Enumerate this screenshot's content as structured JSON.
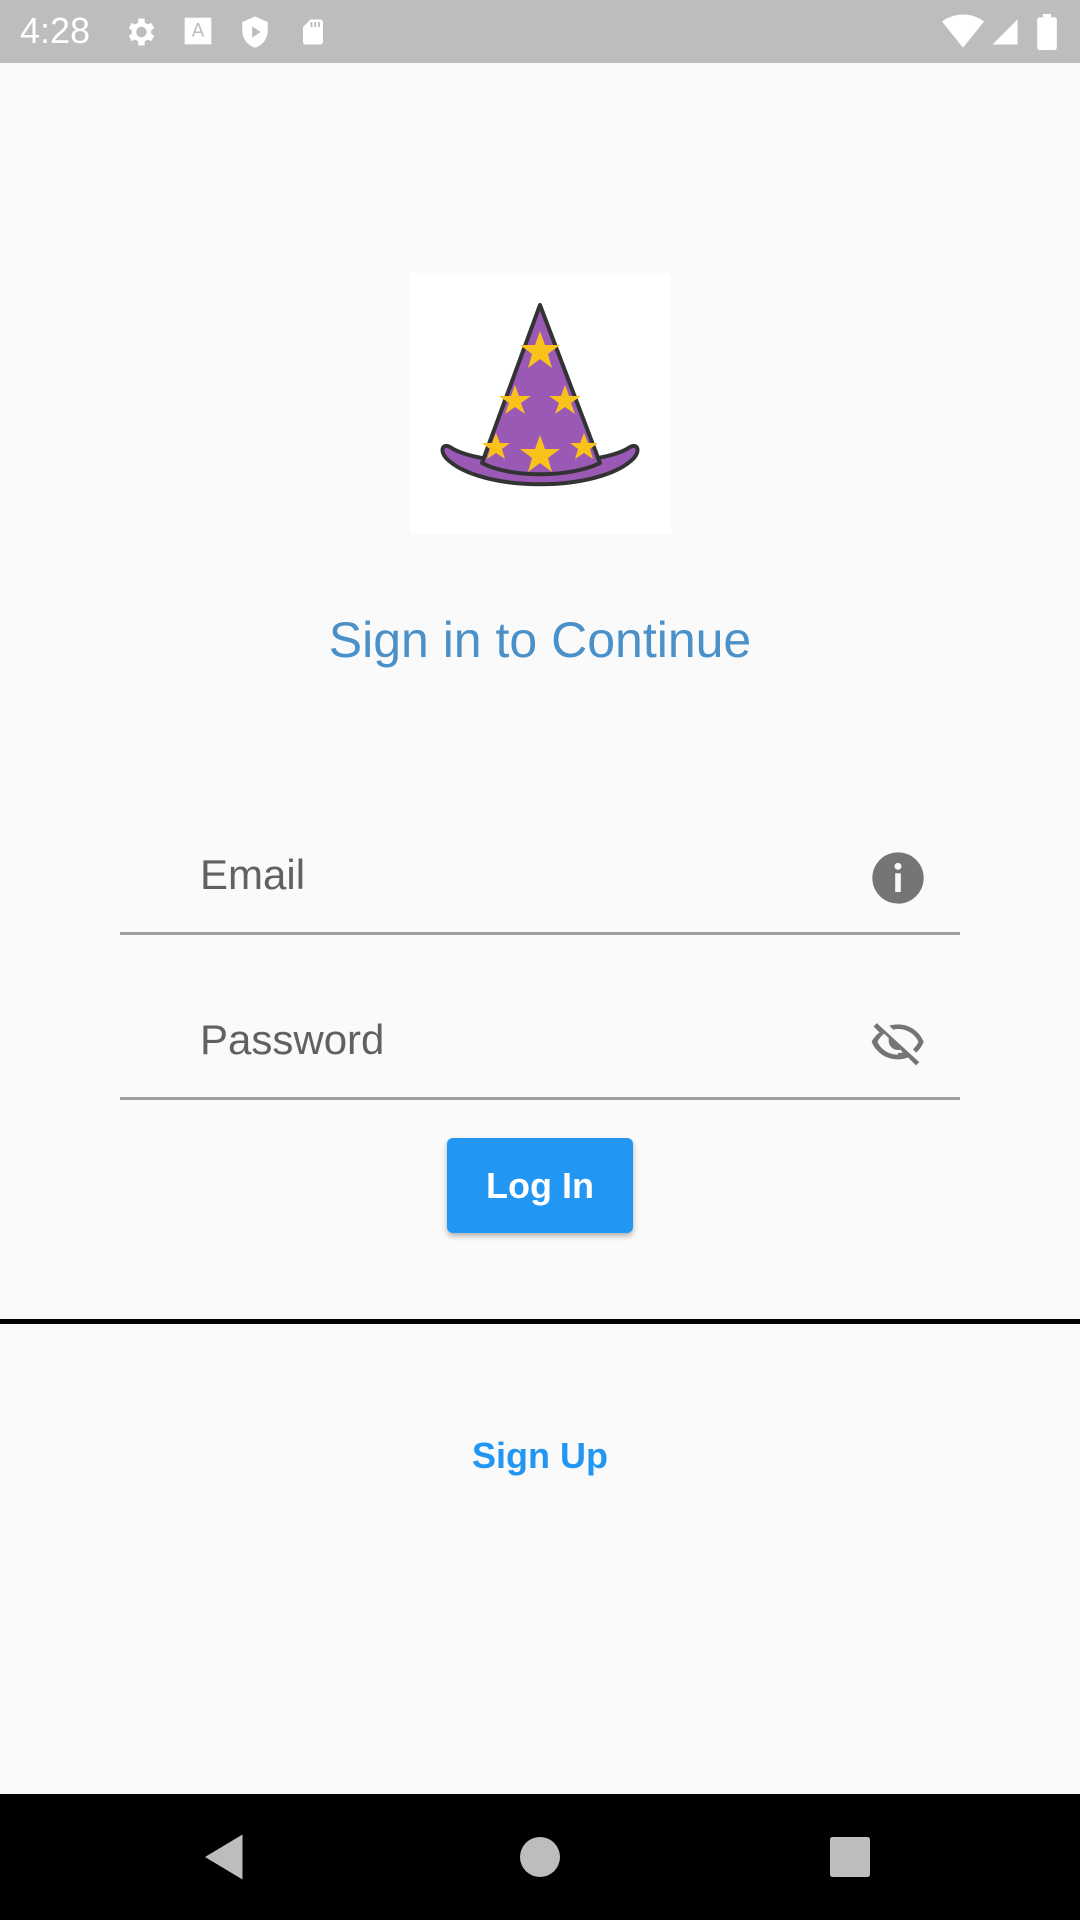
{
  "status_bar": {
    "time": "4:28",
    "icons": [
      "gear-icon",
      "text-a-icon",
      "shield-play-icon",
      "sd-card-icon",
      "wifi-icon",
      "signal-icon",
      "battery-icon"
    ]
  },
  "logo": {
    "icon": "wizard-hat-icon",
    "colors": {
      "hat": "#9b59b6",
      "stars": "#f9c21b"
    }
  },
  "title": "Sign in to Continue",
  "form": {
    "email_placeholder": "Email",
    "password_placeholder": "Password",
    "email_icon": "info-icon",
    "password_icon": "visibility-off-icon"
  },
  "login_button": {
    "label": "Log In",
    "color": "#2196f3"
  },
  "signup_link": {
    "label": "Sign Up"
  },
  "nav_bar": {
    "buttons": [
      "back-icon",
      "home-icon",
      "recents-icon"
    ]
  },
  "colors": {
    "accent": "#2196f3",
    "title": "#4a90c9",
    "background": "#fafafa"
  }
}
